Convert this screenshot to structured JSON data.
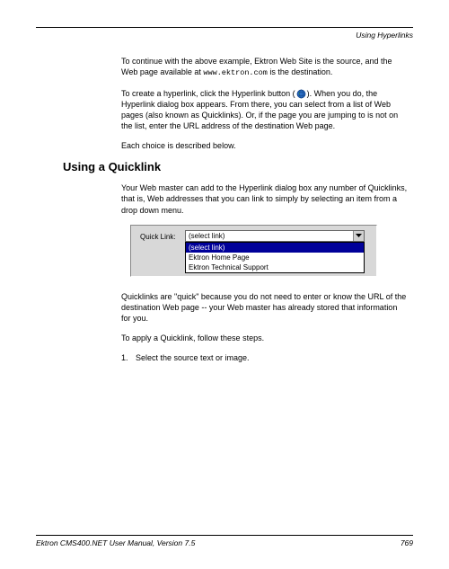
{
  "header": {
    "section": "Using Hyperlinks"
  },
  "para1a": "To continue with the above example, Ektron Web Site is the source, and the Web page available at ",
  "para1_url": "www.ektron.com",
  "para1b": " is the destination.",
  "para2a": "To create a hyperlink, click the Hyperlink button (",
  "para2b": "). When you do, the Hyperlink dialog box appears. From there, you can select from a list of Web pages (also known as Quicklinks). Or, if the page you are jumping to is not on the list, enter the URL address of the destination Web page.",
  "para3": "Each choice is described below.",
  "heading": "Using a Quicklink",
  "para4": "Your Web master can add to the Hyperlink dialog box any number of Quicklinks, that is, Web addresses that you can link to simply by selecting an item from a drop down menu.",
  "dropdown": {
    "label": "Quick Link:",
    "selected": "(select link)",
    "options": [
      "(select link)",
      "Ektron Home Page",
      "Ektron Technical Support"
    ]
  },
  "para5": "Quicklinks are \"quick\" because you do not need to enter or know the URL of the destination Web page -- your Web master has already stored that information for you.",
  "para6": "To apply a Quicklink, follow these steps.",
  "step1": "Select the source text or image.",
  "footer": {
    "manual": "Ektron CMS400.NET User Manual, Version 7.5",
    "page": "769"
  }
}
